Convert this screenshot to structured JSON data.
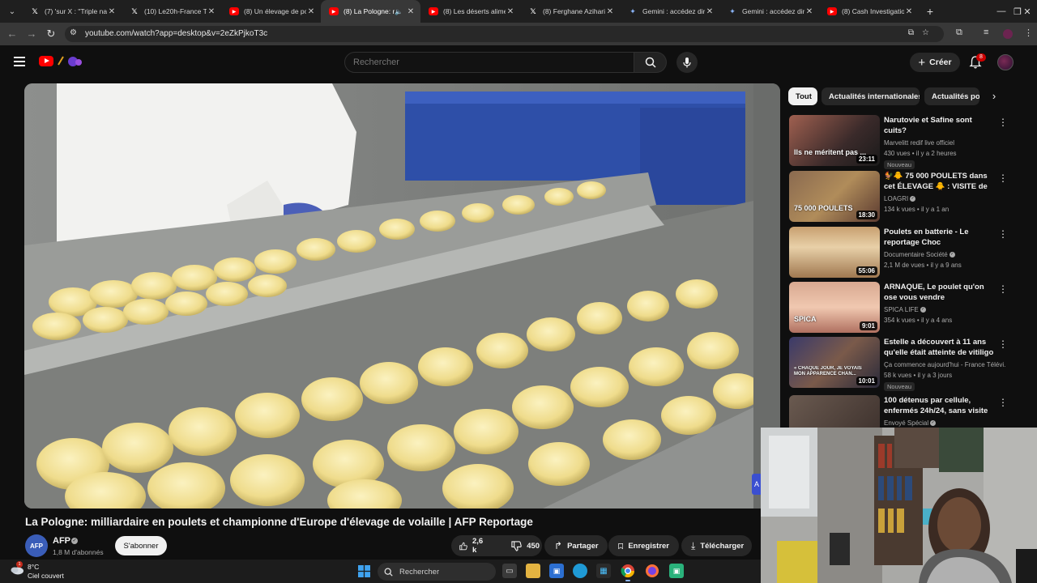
{
  "browser": {
    "tabs": [
      {
        "favicon": "x-logo",
        "title": "(7) 'sur X : \"Triple nati",
        "active": false
      },
      {
        "favicon": "x-logo",
        "title": "(10) Le20h-France Télé",
        "active": false
      },
      {
        "favicon": "youtube-logo",
        "title": "(8) Un élevage de pou",
        "active": false
      },
      {
        "favicon": "youtube-logo",
        "title": "(8) La Pologne: m",
        "active": true,
        "audio": true
      },
      {
        "favicon": "youtube-logo",
        "title": "(8) Les déserts alimen",
        "active": false
      },
      {
        "favicon": "x-logo",
        "title": "(8) Ferghane Azihari (",
        "active": false
      },
      {
        "favicon": "gemini-logo",
        "title": "Gemini : accédez dire",
        "active": false
      },
      {
        "favicon": "gemini-logo",
        "title": "Gemini : accédez dire",
        "active": false
      },
      {
        "favicon": "youtube-logo",
        "title": "(8) Cash Investigation",
        "active": false
      }
    ],
    "url": "youtube.com/watch?app=desktop&v=2eZkPjkoT3c"
  },
  "youtube": {
    "search_placeholder": "Rechercher",
    "create_label": "Créer",
    "notification_count": "8"
  },
  "video": {
    "title": "La Pologne: milliardaire en poulets et championne d'Europe d'élevage de volaille | AFP Reportage",
    "channel_avatar": "AFP",
    "channel_name": "AFP",
    "subscribers": "1,8 M d'abonnés",
    "subscribe_label": "S'abonner",
    "likes": "2,6 k",
    "dislikes": "450",
    "share_label": "Partager",
    "save_label": "Enregistrer",
    "download_label": "Télécharger"
  },
  "chips": [
    "Tout",
    "Actualités internationales",
    "Actualités po"
  ],
  "recommendations": [
    {
      "title": "Narutovie et Safine sont cuits?",
      "channel": "Marvelitt redif live officiel",
      "verified": false,
      "views": "430 vues",
      "age": "il y a 2 heures",
      "duration": "23:11",
      "badge": "Nouveau",
      "thumb_text": "Ils ne méritent pas ..."
    },
    {
      "title": "🐓🐥 75 000 POULETS dans cet ÉLEVAGE 🐥 : VISITE de la ...",
      "channel": "LOAGRI",
      "verified": true,
      "views": "134 k vues",
      "age": "il y a 1 an",
      "duration": "18:30",
      "badge": "",
      "thumb_text": "75 000 POULETS"
    },
    {
      "title": "Poulets en batterie - Le reportage Choc",
      "channel": "Documentaire Société",
      "verified": true,
      "views": "2,1 M de vues",
      "age": "il y a 9 ans",
      "duration": "55:06",
      "badge": "",
      "thumb_text": ""
    },
    {
      "title": "ARNAQUE, Le poulet qu'on ose vous vendre",
      "channel": "SPICA LIFE",
      "verified": true,
      "views": "354 k vues",
      "age": "il y a 4 ans",
      "duration": "9:01",
      "badge": "",
      "thumb_text": "SPICA"
    },
    {
      "title": "Estelle a découvert à 11 ans qu'elle était atteinte de vitiligo",
      "channel": "Ça commence aujourd'hui - France Télévi...",
      "verified": false,
      "views": "58 k vues",
      "age": "il y a 3 jours",
      "duration": "10:01",
      "badge": "Nouveau",
      "thumb_text": "« CHAQUE JOUR, JE VOYAIS MON APPARENCE CHAN..."
    },
    {
      "title": "100 détenus par cellule, enfermés 24h/24, sans visite ...",
      "channel": "Envoyé Spécial",
      "verified": true,
      "views": "",
      "age": "",
      "duration": "",
      "badge": "",
      "thumb_text": ""
    }
  ],
  "taskbar": {
    "temperature": "8°C",
    "weather": "Ciel couvert",
    "weather_badge": "1",
    "search_label": "Rechercher"
  },
  "side_button": "A"
}
